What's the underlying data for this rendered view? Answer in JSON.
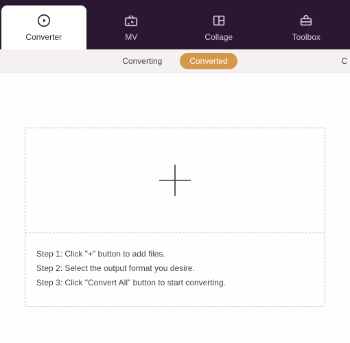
{
  "topTabs": [
    {
      "label": "Converter",
      "iconName": "converter-icon",
      "active": true
    },
    {
      "label": "MV",
      "iconName": "mv-icon",
      "active": false
    },
    {
      "label": "Collage",
      "iconName": "collage-icon",
      "active": false
    },
    {
      "label": "Toolbox",
      "iconName": "toolbox-icon",
      "active": false
    }
  ],
  "subTabs": {
    "converting": "Converting",
    "converted": "Converted",
    "extraRight": "C"
  },
  "steps": {
    "s1": "Step 1: Click \"+\" button to add files.",
    "s2": "Step 2: Select the output format you desire.",
    "s3": "Step 3: Click \"Convert All\" button to start converting."
  },
  "icons": {
    "converter": "converter-icon",
    "mv": "mv-icon",
    "collage": "collage-icon",
    "toolbox": "toolbox-icon",
    "plus": "plus-icon"
  },
  "colors": {
    "topbarBg": "#2c1733",
    "accent": "#d5984a"
  }
}
